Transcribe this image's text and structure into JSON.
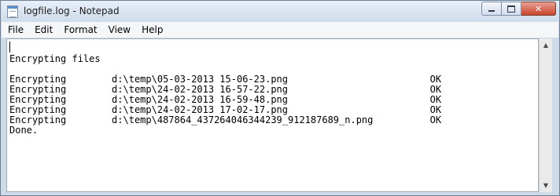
{
  "window": {
    "title": "logfile.log - Notepad",
    "close_glyph": "✕"
  },
  "menu": {
    "file": "File",
    "edit": "Edit",
    "format": "Format",
    "view": "View",
    "help": "Help"
  },
  "editor": {
    "content": "\nEncrypting files\n\nEncrypting        d:\\temp\\05-03-2013 15-06-23.png                         OK\nEncrypting        d:\\temp\\24-02-2013 16-57-22.png                         OK\nEncrypting        d:\\temp\\24-02-2013 16-59-48.png                         OK\nEncrypting        d:\\temp\\24-02-2013 17-02-17.png                         OK\nEncrypting        d:\\temp\\487864_437264046344239_912187689_n.png          OK\nDone."
  },
  "scrollbar": {
    "up_arrow": "▲",
    "down_arrow": "▼"
  }
}
